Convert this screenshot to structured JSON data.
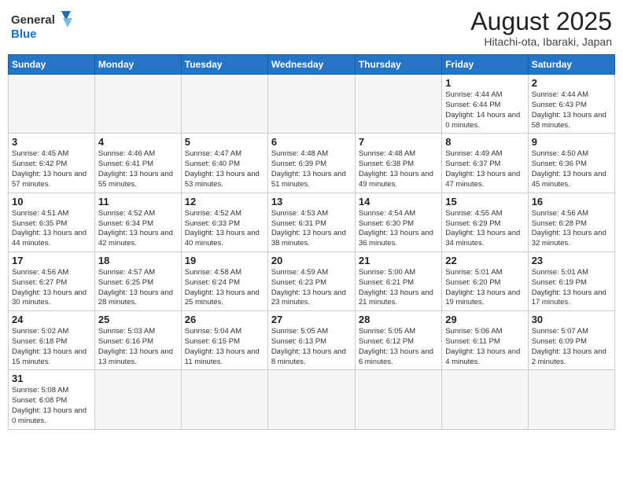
{
  "logo": {
    "text_general": "General",
    "text_blue": "Blue"
  },
  "title": "August 2025",
  "location": "Hitachi-ota, Ibaraki, Japan",
  "headers": [
    "Sunday",
    "Monday",
    "Tuesday",
    "Wednesday",
    "Thursday",
    "Friday",
    "Saturday"
  ],
  "weeks": [
    [
      {
        "day": "",
        "info": ""
      },
      {
        "day": "",
        "info": ""
      },
      {
        "day": "",
        "info": ""
      },
      {
        "day": "",
        "info": ""
      },
      {
        "day": "",
        "info": ""
      },
      {
        "day": "1",
        "info": "Sunrise: 4:44 AM\nSunset: 6:44 PM\nDaylight: 14 hours\nand 0 minutes."
      },
      {
        "day": "2",
        "info": "Sunrise: 4:44 AM\nSunset: 6:43 PM\nDaylight: 13 hours\nand 58 minutes."
      }
    ],
    [
      {
        "day": "3",
        "info": "Sunrise: 4:45 AM\nSunset: 6:42 PM\nDaylight: 13 hours\nand 57 minutes."
      },
      {
        "day": "4",
        "info": "Sunrise: 4:46 AM\nSunset: 6:41 PM\nDaylight: 13 hours\nand 55 minutes."
      },
      {
        "day": "5",
        "info": "Sunrise: 4:47 AM\nSunset: 6:40 PM\nDaylight: 13 hours\nand 53 minutes."
      },
      {
        "day": "6",
        "info": "Sunrise: 4:48 AM\nSunset: 6:39 PM\nDaylight: 13 hours\nand 51 minutes."
      },
      {
        "day": "7",
        "info": "Sunrise: 4:48 AM\nSunset: 6:38 PM\nDaylight: 13 hours\nand 49 minutes."
      },
      {
        "day": "8",
        "info": "Sunrise: 4:49 AM\nSunset: 6:37 PM\nDaylight: 13 hours\nand 47 minutes."
      },
      {
        "day": "9",
        "info": "Sunrise: 4:50 AM\nSunset: 6:36 PM\nDaylight: 13 hours\nand 45 minutes."
      }
    ],
    [
      {
        "day": "10",
        "info": "Sunrise: 4:51 AM\nSunset: 6:35 PM\nDaylight: 13 hours\nand 44 minutes."
      },
      {
        "day": "11",
        "info": "Sunrise: 4:52 AM\nSunset: 6:34 PM\nDaylight: 13 hours\nand 42 minutes."
      },
      {
        "day": "12",
        "info": "Sunrise: 4:52 AM\nSunset: 6:33 PM\nDaylight: 13 hours\nand 40 minutes."
      },
      {
        "day": "13",
        "info": "Sunrise: 4:53 AM\nSunset: 6:31 PM\nDaylight: 13 hours\nand 38 minutes."
      },
      {
        "day": "14",
        "info": "Sunrise: 4:54 AM\nSunset: 6:30 PM\nDaylight: 13 hours\nand 36 minutes."
      },
      {
        "day": "15",
        "info": "Sunrise: 4:55 AM\nSunset: 6:29 PM\nDaylight: 13 hours\nand 34 minutes."
      },
      {
        "day": "16",
        "info": "Sunrise: 4:56 AM\nSunset: 6:28 PM\nDaylight: 13 hours\nand 32 minutes."
      }
    ],
    [
      {
        "day": "17",
        "info": "Sunrise: 4:56 AM\nSunset: 6:27 PM\nDaylight: 13 hours\nand 30 minutes."
      },
      {
        "day": "18",
        "info": "Sunrise: 4:57 AM\nSunset: 6:25 PM\nDaylight: 13 hours\nand 28 minutes."
      },
      {
        "day": "19",
        "info": "Sunrise: 4:58 AM\nSunset: 6:24 PM\nDaylight: 13 hours\nand 25 minutes."
      },
      {
        "day": "20",
        "info": "Sunrise: 4:59 AM\nSunset: 6:23 PM\nDaylight: 13 hours\nand 23 minutes."
      },
      {
        "day": "21",
        "info": "Sunrise: 5:00 AM\nSunset: 6:21 PM\nDaylight: 13 hours\nand 21 minutes."
      },
      {
        "day": "22",
        "info": "Sunrise: 5:01 AM\nSunset: 6:20 PM\nDaylight: 13 hours\nand 19 minutes."
      },
      {
        "day": "23",
        "info": "Sunrise: 5:01 AM\nSunset: 6:19 PM\nDaylight: 13 hours\nand 17 minutes."
      }
    ],
    [
      {
        "day": "24",
        "info": "Sunrise: 5:02 AM\nSunset: 6:18 PM\nDaylight: 13 hours\nand 15 minutes."
      },
      {
        "day": "25",
        "info": "Sunrise: 5:03 AM\nSunset: 6:16 PM\nDaylight: 13 hours\nand 13 minutes."
      },
      {
        "day": "26",
        "info": "Sunrise: 5:04 AM\nSunset: 6:15 PM\nDaylight: 13 hours\nand 11 minutes."
      },
      {
        "day": "27",
        "info": "Sunrise: 5:05 AM\nSunset: 6:13 PM\nDaylight: 13 hours\nand 8 minutes."
      },
      {
        "day": "28",
        "info": "Sunrise: 5:05 AM\nSunset: 6:12 PM\nDaylight: 13 hours\nand 6 minutes."
      },
      {
        "day": "29",
        "info": "Sunrise: 5:06 AM\nSunset: 6:11 PM\nDaylight: 13 hours\nand 4 minutes."
      },
      {
        "day": "30",
        "info": "Sunrise: 5:07 AM\nSunset: 6:09 PM\nDaylight: 13 hours\nand 2 minutes."
      }
    ],
    [
      {
        "day": "31",
        "info": "Sunrise: 5:08 AM\nSunset: 6:08 PM\nDaylight: 13 hours\nand 0 minutes."
      },
      {
        "day": "",
        "info": ""
      },
      {
        "day": "",
        "info": ""
      },
      {
        "day": "",
        "info": ""
      },
      {
        "day": "",
        "info": ""
      },
      {
        "day": "",
        "info": ""
      },
      {
        "day": "",
        "info": ""
      }
    ]
  ]
}
